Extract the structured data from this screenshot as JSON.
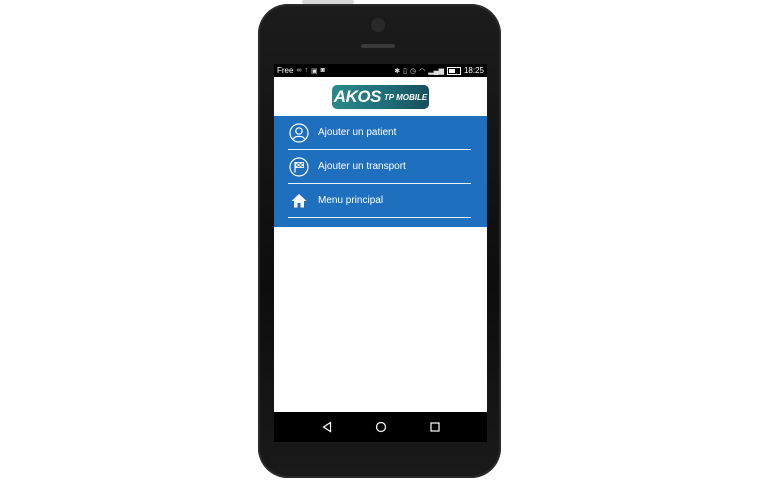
{
  "statusbar": {
    "carrier": "Free",
    "time": "18:25"
  },
  "app": {
    "logo_main": "AKOS",
    "logo_sub": "TP MOBILE"
  },
  "menu": {
    "items": [
      {
        "label": "Ajouter un patient",
        "icon": "user-icon"
      },
      {
        "label": "Ajouter un transport",
        "icon": "checkered-flag-icon"
      },
      {
        "label": "Menu principal",
        "icon": "home-icon"
      }
    ]
  },
  "colors": {
    "menu_bg": "#1f6fbf",
    "logo_bg": "#1f6d7a"
  },
  "navbar": {
    "buttons": [
      "back-icon",
      "home-circle-icon",
      "recents-icon"
    ]
  }
}
